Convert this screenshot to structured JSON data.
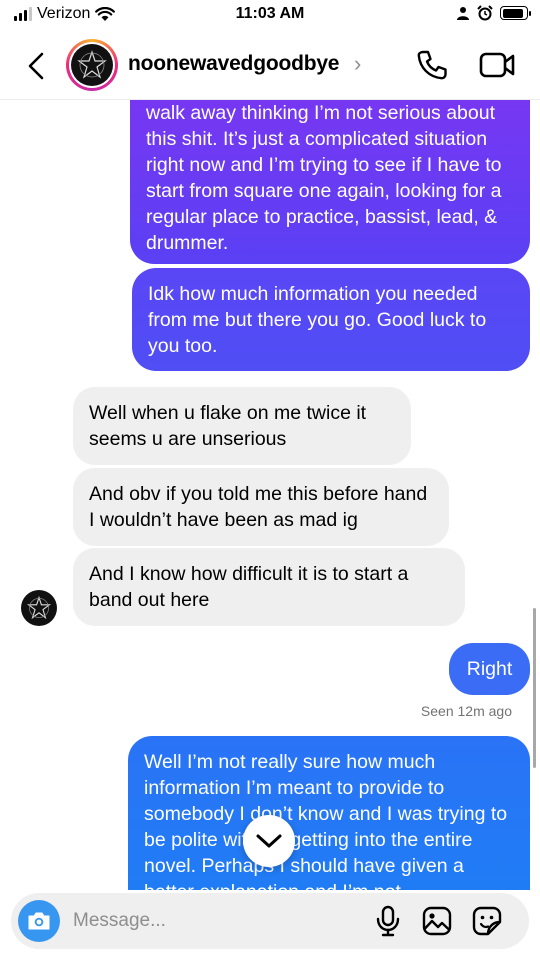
{
  "status_bar": {
    "carrier": "Verizon",
    "time": "11:03 AM",
    "battery_level": 0.9
  },
  "header": {
    "username": "noonewavedgoodbye",
    "chevron": "›",
    "icons": {
      "back": "chevron-left-icon",
      "call": "phone-icon",
      "video": "video-camera-icon"
    }
  },
  "messages": [
    {
      "direction": "outgoing",
      "text": "walk away thinking I’m not serious about this shit. It’s just a complicated situation right now and I’m trying to see if I have to start from square one again, looking for a regular place to practice, bassist, lead, & drummer."
    },
    {
      "direction": "outgoing",
      "text": "Idk how much information you needed from me but there you go. Good luck to you too."
    },
    {
      "direction": "incoming",
      "text": "Well when u flake on me twice it seems u are unserious"
    },
    {
      "direction": "incoming",
      "text": "And obv if you told me this before hand I wouldn’t have been as mad ig"
    },
    {
      "direction": "incoming",
      "text": "And I know how difficult it is to start a band out here"
    },
    {
      "direction": "outgoing",
      "text": "Right"
    },
    {
      "direction": "outgoing",
      "text": "Well I’m not really sure how much information I’m meant to provide to somebody I don’t know and I was trying to be polite without getting into the entire novel. Perhaps I should have given a better explanation and I’m not"
    }
  ],
  "seen_status": "Seen 12m ago",
  "composer": {
    "placeholder": "Message...",
    "value": "",
    "icons": {
      "camera": "camera-icon",
      "mic": "microphone-icon",
      "gallery": "image-gallery-icon",
      "sticker": "sticker-icon"
    }
  },
  "colors": {
    "outgoing_top": "#7a36f2",
    "outgoing_mid": "#3b6cf6",
    "outgoing_bottom": "#1d7ff5",
    "incoming": "#efefef",
    "camera_button": "#3797f0",
    "seen_text": "#737373"
  }
}
